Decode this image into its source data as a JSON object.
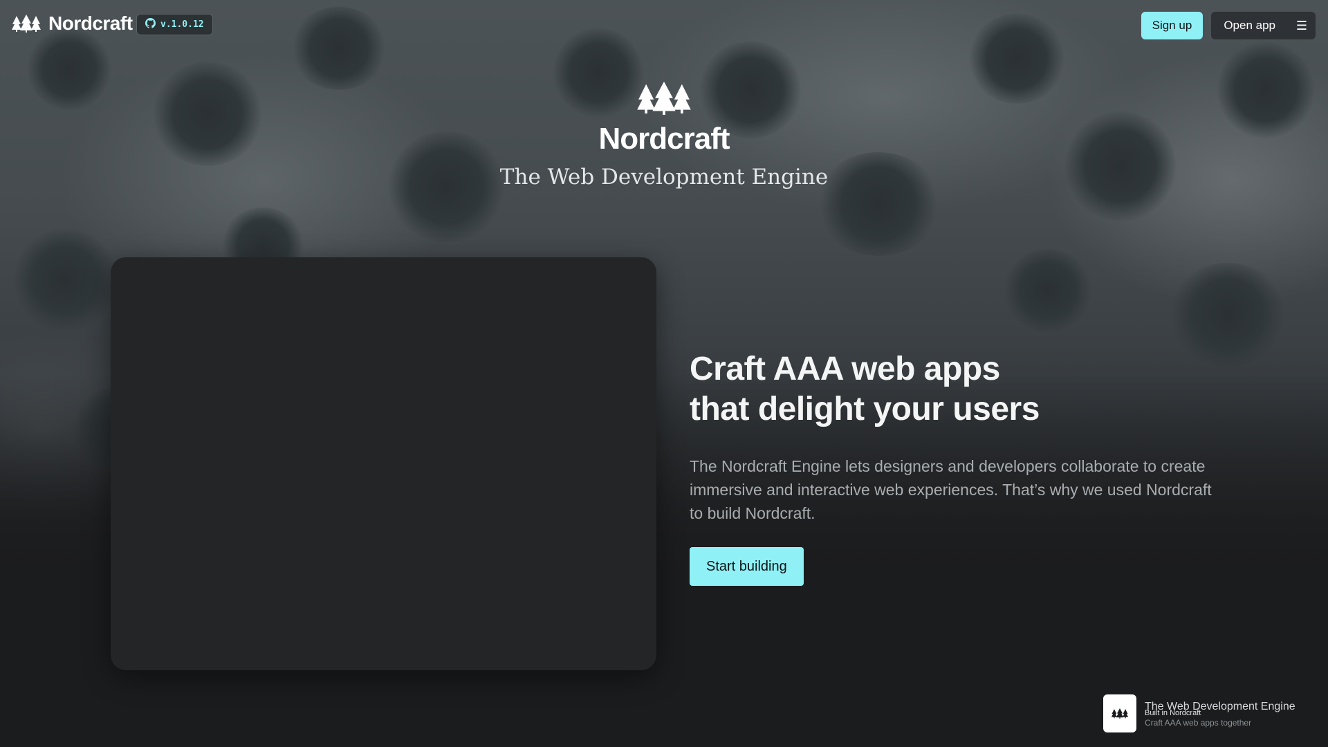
{
  "colors": {
    "accent": "#8ff1f6",
    "background": "#1b1c1e",
    "card": "#242526",
    "body_text": "#a9adb0"
  },
  "topbar": {
    "brand_name": "Nordcraft",
    "logo_icon": "three-trees-logo-icon",
    "version_icon": "github-icon",
    "version": "v.1.0.12",
    "signup_label": "Sign up",
    "open_app_label": "Open app",
    "menu_icon": "hamburger-menu-icon"
  },
  "hero": {
    "title": "Nordcraft",
    "subtitle": "The Web Development Engine"
  },
  "pitch": {
    "headline_line1": "Craft AAA web apps",
    "headline_line2": "that delight your users",
    "body": "The Nordcraft Engine lets designers and developers collaborate to create immersive and interactive web experiences. That’s why we used Nordcraft to build Nordcraft.",
    "cta_label": "Start building"
  },
  "built_badge": {
    "title": "The Web Development Engine",
    "label": "Built in Nordcraft",
    "tagline": "Craft AAA web apps together"
  }
}
